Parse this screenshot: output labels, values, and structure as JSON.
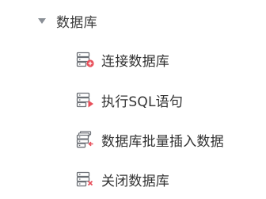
{
  "tree": {
    "group": {
      "label": "数据库",
      "expanded": true,
      "caret_icon": "caret-down-icon"
    },
    "items": [
      {
        "label": "连接数据库",
        "icon": "db-connect-icon",
        "accent": "#e8505b"
      },
      {
        "label": "执行SQL语句",
        "icon": "db-execute-sql-icon",
        "accent": "#e8505b"
      },
      {
        "label": "数据库批量插入数据",
        "icon": "db-batch-insert-icon",
        "accent": "#e8505b"
      },
      {
        "label": "关闭数据库",
        "icon": "db-close-icon",
        "accent": "#e8505b"
      }
    ]
  },
  "colors": {
    "icon_stroke": "#6b6f75",
    "accent": "#e8505b",
    "text": "#333333",
    "caret": "#8a8f96"
  }
}
